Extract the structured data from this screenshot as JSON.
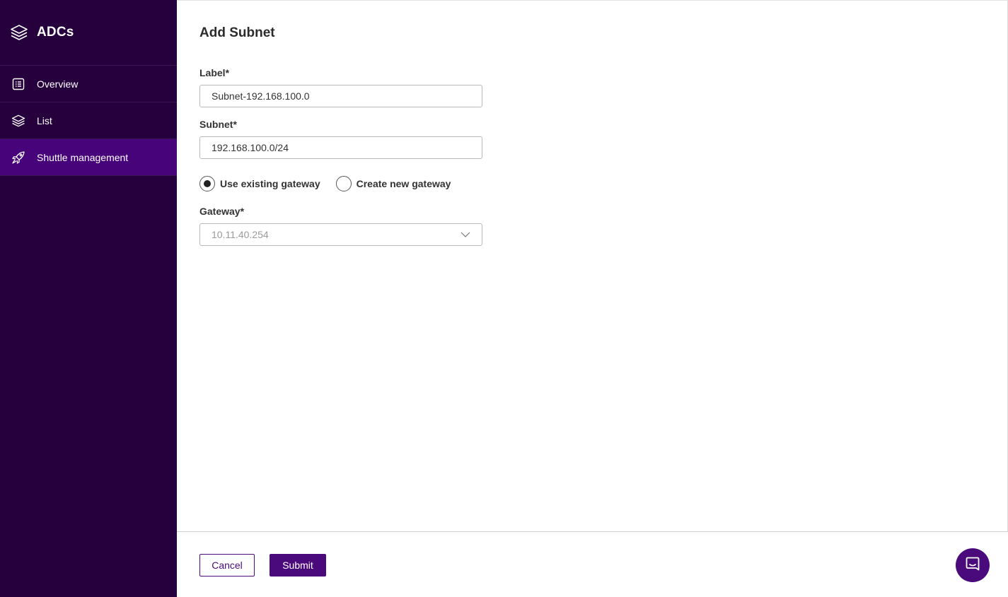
{
  "sidebar": {
    "app_title": "ADCs",
    "items": [
      {
        "label": "Overview",
        "icon": "overview-list-icon",
        "active": false
      },
      {
        "label": "List",
        "icon": "layers-icon",
        "active": false
      },
      {
        "label": "Shuttle management",
        "icon": "rocket-icon",
        "active": true
      }
    ]
  },
  "form": {
    "title": "Add Subnet",
    "label_field": {
      "label": "Label*",
      "value": "Subnet-192.168.100.0"
    },
    "subnet_field": {
      "label": "Subnet*",
      "value": "192.168.100.0/24"
    },
    "gateway_mode": {
      "options": [
        "Use existing gateway",
        "Create new gateway"
      ],
      "selected": "Use existing gateway"
    },
    "gateway_field": {
      "label": "Gateway*",
      "value": "10.11.40.254"
    }
  },
  "footer": {
    "cancel_label": "Cancel",
    "submit_label": "Submit"
  },
  "colors": {
    "sidebar_bg": "#25003d",
    "sidebar_active": "#47047a",
    "accent": "#4a0a7c"
  }
}
